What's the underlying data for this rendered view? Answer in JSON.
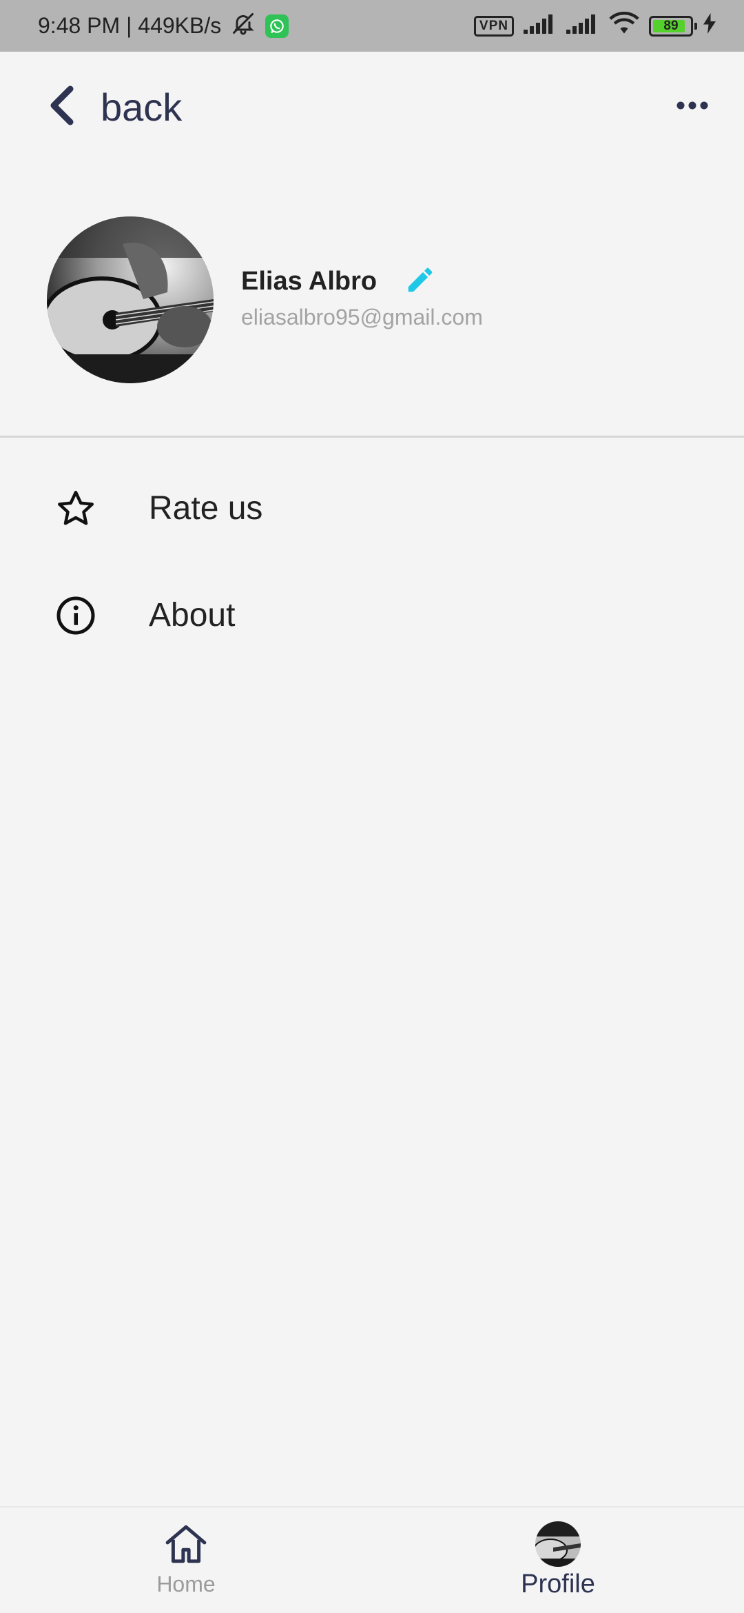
{
  "status_bar": {
    "time_speed": "9:48 PM | 449KB/s",
    "mute_icon": "bell-slash-icon",
    "whatsapp_icon": "whatsapp-icon",
    "vpn": "VPN",
    "battery_level": "89",
    "battery_fraction": 0.89,
    "charging_icon": "bolt-icon"
  },
  "header": {
    "back_icon": "chevron-left-icon",
    "back_label": "back",
    "more_icon": "more-horizontal-icon"
  },
  "profile": {
    "name": "Elias Albro",
    "email": "eliasalbro95@gmail.com",
    "edit_icon": "pencil-icon",
    "avatar": "avatar-photo"
  },
  "menu": {
    "items": [
      {
        "label": "Rate us",
        "icon": "star-icon"
      },
      {
        "label": "About",
        "icon": "info-circle-icon"
      }
    ]
  },
  "bottom_nav": {
    "items": [
      {
        "label": "Home",
        "icon": "home-icon",
        "active": false
      },
      {
        "label": "Profile",
        "icon": "avatar-photo",
        "active": true
      }
    ]
  },
  "colors": {
    "background": "#f4f4f4",
    "status_bar": "#b4b4b4",
    "accent": "#1ec8e6",
    "dark_text": "#2d3350",
    "muted_text": "#a3a3a3"
  }
}
